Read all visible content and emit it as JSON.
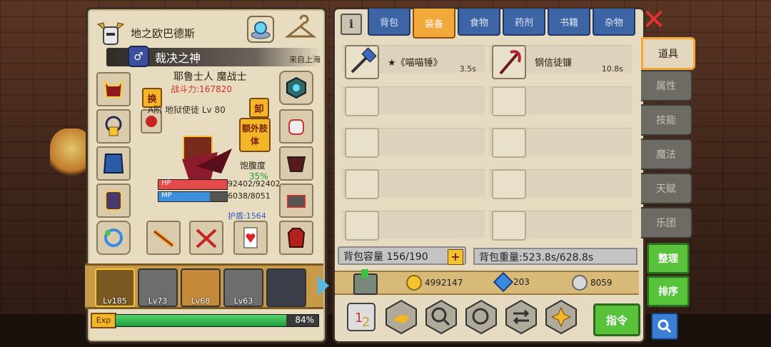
{
  "character": {
    "name": "地之欧巴德斯",
    "title": "裁决之神",
    "origin": "来自上海",
    "gender_icon": "male-icon",
    "class": "耶鲁士人 魔战士",
    "power": "战斗力:167820",
    "weapon_info": "A阶 地狱使徒 Lv 80",
    "swap_label": "换",
    "unequip_label": "卸",
    "extra_limb_label": "额外肢体",
    "satiety_label": "饱腹度",
    "satiety_value": "35%",
    "hp_label": "HP",
    "hp_value": "92402/92402",
    "hp_fraction": 1.0,
    "mp_label": "MP",
    "mp_value": "6038/8051",
    "mp_fraction": 0.75,
    "shield": "护盾:1564"
  },
  "party": [
    {
      "level": "Lv185",
      "active": true
    },
    {
      "level": "Lv73",
      "active": false
    },
    {
      "level": "Lv68",
      "active": false
    },
    {
      "level": "Lv63",
      "active": false
    },
    {
      "level": "",
      "active": false
    }
  ],
  "exp": {
    "label": "Exp",
    "percent": "84%",
    "fraction": 0.84
  },
  "inventory": {
    "tabs": [
      "背包",
      "装备",
      "食物",
      "药剂",
      "书籍",
      "杂物"
    ],
    "active_tab": "装备",
    "items": [
      {
        "name": "★《喵喵锤》",
        "weight": "3.5s"
      },
      {
        "name": "钢信徒镰",
        "weight": "10.8s"
      }
    ],
    "capacity": "背包容量 156/190",
    "weight_total": "背包重量:523.8s/628.8s",
    "gold": "4992147",
    "gems": "203",
    "silver": "8059",
    "command_label": "指令"
  },
  "side_tabs": [
    "道具",
    "属性",
    "技能",
    "魔法",
    "天赋",
    "乐团"
  ],
  "side_buttons": {
    "arrange": "整理",
    "sort": "排序"
  },
  "colors": {
    "accent": "#f2a93a",
    "tab_blue": "#3d65a5",
    "green_button": "#57c23a",
    "panel": "#e8dcc0"
  }
}
